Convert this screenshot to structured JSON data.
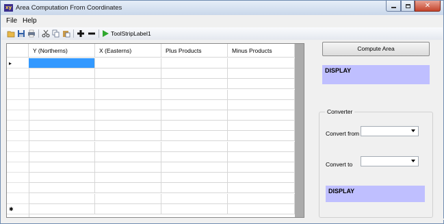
{
  "window": {
    "title": "Area Computation From Coordinates",
    "icon_text": "xy"
  },
  "menu": {
    "items": [
      "File",
      "Help"
    ]
  },
  "toolbar": {
    "icons": [
      "open-folder-icon",
      "save-icon",
      "print-icon",
      "cut-icon",
      "copy-icon",
      "paste-icon",
      "add-icon",
      "remove-icon",
      "run-icon"
    ],
    "label": "ToolStripLabel1"
  },
  "grid": {
    "columns": [
      "Y (Northerns)",
      "X (Easterns)",
      "Plus Products",
      "Minus Products"
    ],
    "current_row_marker": "▸",
    "new_row_marker": "✱",
    "selected_cell": {
      "row": 0,
      "col": 0
    },
    "selected_color": "#3399ff"
  },
  "panel": {
    "compute_button": "Compute Area",
    "area_display": "DISPLAY",
    "converter": {
      "title": "Converter",
      "from_label": "Convert from",
      "from_value": "",
      "to_label": "Convert to",
      "to_value": "",
      "result_display": "DISPLAY"
    },
    "display_color": "#bfbfff"
  }
}
